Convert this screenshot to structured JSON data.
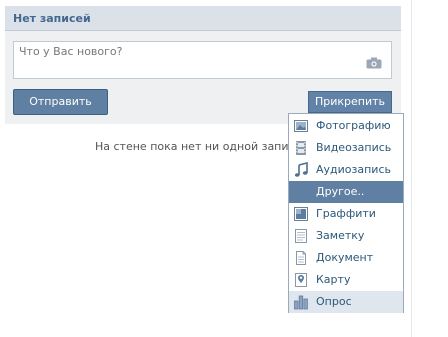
{
  "wall": {
    "title": "Нет записей",
    "input_placeholder": "Что у Вас нового?",
    "send_label": "Отправить",
    "attach_label": "Прикрепить",
    "empty_message": "На стене пока нет ни одной записи"
  },
  "attach_menu": {
    "items": [
      {
        "label": "Фотографию",
        "icon": "photo-icon"
      },
      {
        "label": "Видеозапись",
        "icon": "video-icon"
      },
      {
        "label": "Аудиозапись",
        "icon": "music-note-icon"
      },
      {
        "label": "Другое..",
        "icon": "",
        "state": "selected"
      },
      {
        "label": "Граффити",
        "icon": "graffiti-icon"
      },
      {
        "label": "Заметку",
        "icon": "note-icon"
      },
      {
        "label": "Документ",
        "icon": "document-icon"
      },
      {
        "label": "Карту",
        "icon": "map-pin-icon"
      },
      {
        "label": "Опрос",
        "icon": "poll-chart-icon",
        "state": "hover"
      }
    ]
  },
  "colors": {
    "header_bg": "#dae1e8",
    "title_text": "#45688e",
    "button_bg": "#5f7fa3",
    "menu_text": "#2b587a",
    "menu_selected_bg": "#5f7fa3",
    "menu_hover_bg": "#dfe6ee"
  }
}
